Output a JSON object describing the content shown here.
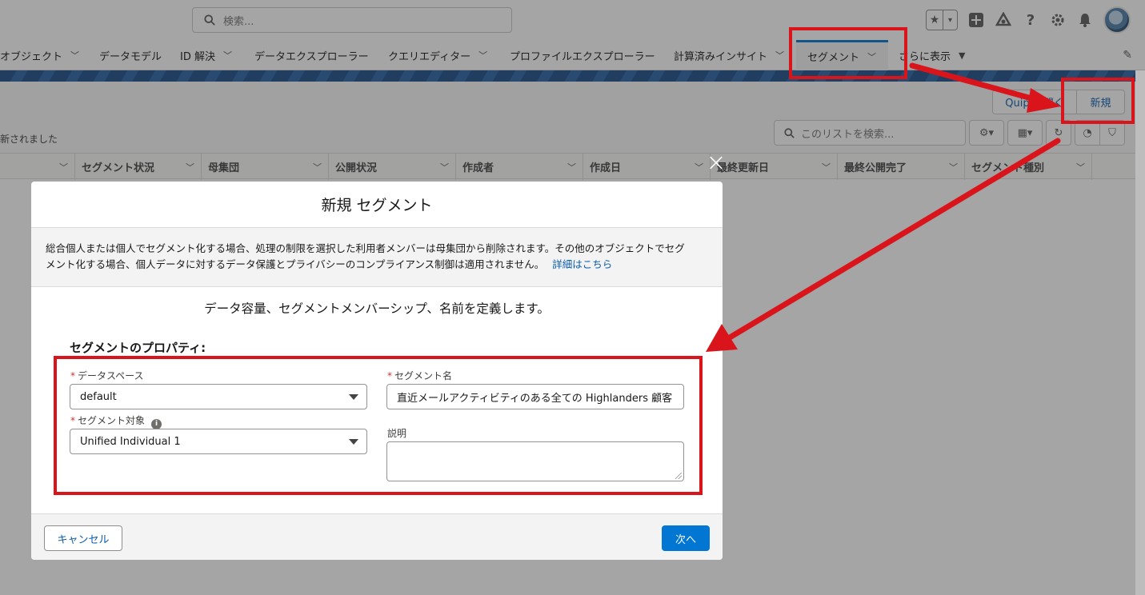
{
  "topbar": {
    "search_placeholder": "検索...",
    "star_icon": "★",
    "dropdown_icon": "▾"
  },
  "nav": {
    "items": [
      {
        "label": "オブジェクト",
        "has_menu": true
      },
      {
        "label": "データモデル",
        "has_menu": false
      },
      {
        "label": "ID 解決",
        "has_menu": true
      },
      {
        "label": "データエクスプローラー",
        "has_menu": false
      },
      {
        "label": "クエリエディター",
        "has_menu": true
      },
      {
        "label": "プロファイルエクスプローラー",
        "has_menu": false
      },
      {
        "label": "計算済みインサイト",
        "has_menu": true
      },
      {
        "label": "セグメント",
        "has_menu": true,
        "active": true
      },
      {
        "label": "さらに表示",
        "has_menu": true
      }
    ]
  },
  "list": {
    "quip_label": "Quip で開く",
    "new_label": "新規",
    "updated_text": "新されました",
    "search_placeholder": "このリストを検索...",
    "columns": [
      "セグメント状況",
      "母集団",
      "公開状況",
      "作成者",
      "作成日",
      "最終更新日",
      "最終公開完了",
      "セグメント種別"
    ]
  },
  "modal": {
    "title": "新規 セグメント",
    "notice_line1": "総合個人または個人でセグメント化する場合、処理の制限を選択した利用者メンバーは母集団から削除されます。その他のオブジェクトでセグ",
    "notice_line2": "メント化する場合、個人データに対するデータ保護とプライバシーのコンプライアンス制御は適用されません。",
    "notice_link": "詳細はこちら",
    "subtitle": "データ容量、セグメントメンバーシップ、名前を定義します。",
    "section_title": "セグメントのプロパティ:",
    "required_mark": "*",
    "data_space_label": "データスペース",
    "data_space_value": "default",
    "segment_on_label": "セグメント対象",
    "segment_on_value": "Unified Individual 1",
    "segment_name_label": "セグメント名",
    "segment_name_value": "直近メールアクティビティのある全ての Highlanders 顧客",
    "description_label": "説明",
    "description_value": "",
    "cancel_label": "キャンセル",
    "next_label": "次へ",
    "close_icon": "×",
    "info_icon": "i"
  },
  "annotations": {
    "highlight_color": "#d9151b"
  }
}
